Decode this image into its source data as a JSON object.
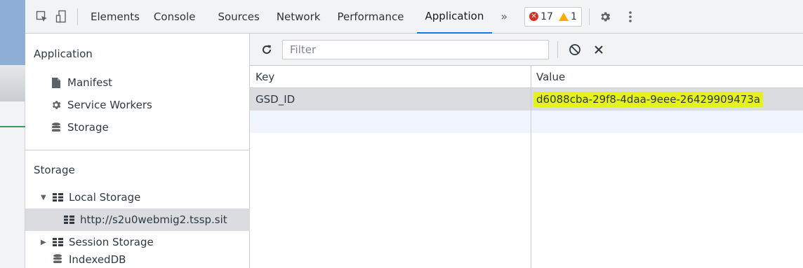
{
  "toolbar": {
    "tabs": [
      {
        "label": "Elements"
      },
      {
        "label": "Console"
      },
      {
        "label": "Sources"
      },
      {
        "label": "Network"
      },
      {
        "label": "Performance"
      },
      {
        "label": "Application",
        "active": true
      }
    ],
    "more_label": "»",
    "error_count": "17",
    "warning_count": "1",
    "icons": [
      "inspect-icon",
      "device-toggle-icon",
      "settings-icon",
      "kebab-menu-icon"
    ]
  },
  "sidebar": {
    "application_section": {
      "title": "Application",
      "items": [
        {
          "label": "Manifest",
          "icon": "file-icon"
        },
        {
          "label": "Service Workers",
          "icon": "gear-icon"
        },
        {
          "label": "Storage",
          "icon": "database-icon"
        }
      ]
    },
    "storage_section": {
      "title": "Storage",
      "items": [
        {
          "label": "Local Storage",
          "icon": "grid-icon",
          "expanded": true
        },
        {
          "label": "http://s2u0webmig2.tssp.sit",
          "icon": "grid-icon",
          "selected": true
        },
        {
          "label": "Session Storage",
          "icon": "grid-icon",
          "expanded": false
        },
        {
          "label": "IndexedDB",
          "icon": "database-icon"
        }
      ]
    }
  },
  "filterbar": {
    "placeholder": "Filter",
    "icons": [
      "refresh-icon",
      "clear-all-icon",
      "delete-icon"
    ]
  },
  "table": {
    "columns": [
      "Key",
      "Value"
    ],
    "rows": [
      {
        "key": "GSD_ID",
        "value": "d6088cba-29f8-4daa-9eee-26429909473a"
      }
    ]
  },
  "colors": {
    "accent": "#1a73e8",
    "highlight": "#e6f21b",
    "error": "#d93025",
    "warning": "#f9ab00"
  }
}
